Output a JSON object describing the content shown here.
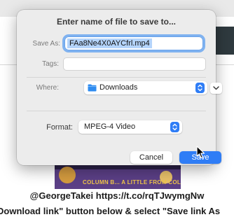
{
  "dialog": {
    "title": "Enter name of file to save to...",
    "save_as_label": "Save As:",
    "filename": "FAa8Ne4X0AYCfrl.mp4",
    "tags_label": "Tags:",
    "tags_value": "",
    "where_label": "Where:",
    "where_value": "Downloads",
    "format_label": "Format:",
    "format_value": "MPEG-4 Video",
    "cancel_label": "Cancel",
    "save_label": "Save"
  },
  "background": {
    "thumbnail_caption": "COLUMN B... A LITTLE FROM COLUMN B",
    "handle_text": "@GeorgeTakei https://t.co/rqTJwymgNw",
    "instruction_text": "Download link\" button below & select \"Save link As"
  },
  "colors": {
    "accent": "#2f7df6",
    "dialog_bg": "#ececec",
    "selection": "#b4d4fb"
  },
  "icons": {
    "where_folder": "folder-icon",
    "where_stepper": "chevron-updown-icon",
    "expand": "chevron-down-icon",
    "format_stepper": "chevron-updown-icon",
    "cursor": "arrow-cursor-icon"
  }
}
